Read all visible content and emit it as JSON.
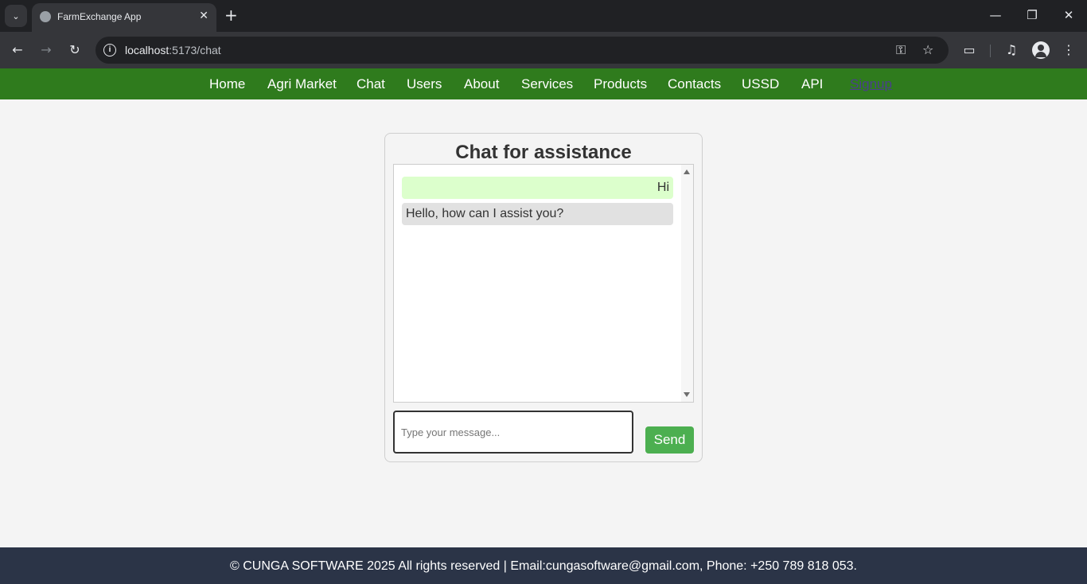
{
  "browser": {
    "tab_title": "FarmExchange App",
    "url_host": "localhost",
    "url_path": ":5173/chat",
    "tab_menu_glyph": "⌄",
    "close_glyph": "✕",
    "new_tab_glyph": "+",
    "icons": {
      "back": "back-arrow-icon",
      "forward": "forward-arrow-icon",
      "reload": "reload-icon",
      "site_info": "info-icon",
      "passwords": "key-icon",
      "bookmark": "star-icon",
      "extensions": "puzzle-icon",
      "media": "media-queue-icon",
      "profile": "profile-icon",
      "menu": "kebab-menu-icon"
    }
  },
  "nav": {
    "items": [
      "Home",
      "Agri Market",
      "Chat",
      "Users",
      "About",
      "Services",
      "Products",
      "Contacts",
      "USSD",
      "API"
    ],
    "signup": "Signup"
  },
  "chat": {
    "title": "Chat for assistance",
    "messages": [
      {
        "sender": "user",
        "text": "Hi"
      },
      {
        "sender": "bot",
        "text": "Hello, how can I assist you?"
      }
    ],
    "input_placeholder": "Type your message...",
    "input_value": "",
    "send_label": "Send"
  },
  "footer": {
    "text": "© CUNGA SOFTWARE 2025 All rights reserved | Email:cungasoftware@gmail.com, Phone: +250 789 818 053."
  },
  "colors": {
    "nav_bg": "#2f7b1d",
    "send_button": "#4caf50",
    "user_bubble": "#dcffcc",
    "bot_bubble": "#e1e1e1",
    "footer_bg": "#2b3447",
    "page_bg": "#f4f4f4"
  }
}
